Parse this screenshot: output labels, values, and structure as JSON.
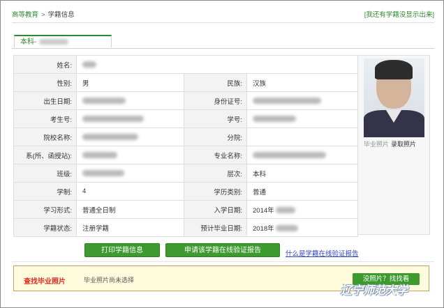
{
  "breadcrumb": {
    "home": "高等教育",
    "separator": ">",
    "current": "学籍信息"
  },
  "top_link": "[我还有学籍没显示出来]",
  "tab": {
    "label": "本科-"
  },
  "table": {
    "rows": [
      [
        {
          "label": "姓名:",
          "value": ""
        }
      ],
      [
        {
          "label": "性别:",
          "value": "男"
        },
        {
          "label": "民族:",
          "value": "汉族"
        }
      ],
      [
        {
          "label": "出生日期:",
          "value": ""
        },
        {
          "label": "身份证号:",
          "value": ""
        }
      ],
      [
        {
          "label": "考生号:",
          "value": ""
        },
        {
          "label": "学号:",
          "value": ""
        }
      ],
      [
        {
          "label": "院校名称:",
          "value": ""
        },
        {
          "label": "分院:",
          "value": ""
        }
      ],
      [
        {
          "label": "系(所、函授站):",
          "value": ""
        },
        {
          "label": "专业名称:",
          "value": ""
        }
      ],
      [
        {
          "label": "班级:",
          "value": ""
        },
        {
          "label": "层次:",
          "value": "本科"
        }
      ],
      [
        {
          "label": "学制:",
          "value": "4"
        },
        {
          "label": "学历类别:",
          "value": "普通"
        }
      ],
      [
        {
          "label": "学习形式:",
          "value": "普通全日制"
        },
        {
          "label": "入学日期:",
          "value": "2014年"
        }
      ],
      [
        {
          "label": "学籍状态:",
          "value": "注册学籍"
        },
        {
          "label": "预计毕业日期:",
          "value": "2018年"
        }
      ]
    ]
  },
  "photo": {
    "graduation_photo_link": "毕业照片",
    "admission_photo_link": "录取照片"
  },
  "buttons": {
    "print": "打印学籍信息",
    "apply_report": "申请该学籍在线验证报告"
  },
  "help_link": "什么是学籍在线验证报告",
  "graduation_panel": {
    "title": "查找毕业照片",
    "message": "毕业照片尚未选择",
    "find_button": "没照片？找找看"
  },
  "watermark": "辽宁师范大学",
  "colors": {
    "accent_green": "#3c9a2e",
    "link_green": "#2f8a2f",
    "status_red": "#e0301e",
    "panel_bg": "#fffbdc"
  }
}
